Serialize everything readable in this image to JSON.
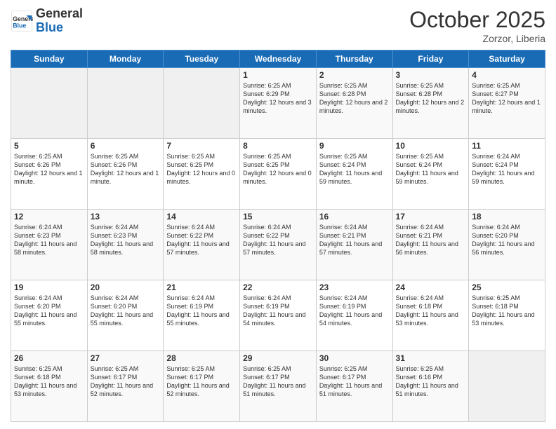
{
  "header": {
    "logo_general": "General",
    "logo_blue": "Blue",
    "month_title": "October 2025",
    "location": "Zorzor, Liberia"
  },
  "days_of_week": [
    "Sunday",
    "Monday",
    "Tuesday",
    "Wednesday",
    "Thursday",
    "Friday",
    "Saturday"
  ],
  "weeks": [
    [
      {
        "day": "",
        "info": ""
      },
      {
        "day": "",
        "info": ""
      },
      {
        "day": "",
        "info": ""
      },
      {
        "day": "1",
        "info": "Sunrise: 6:25 AM\nSunset: 6:29 PM\nDaylight: 12 hours and 3 minutes."
      },
      {
        "day": "2",
        "info": "Sunrise: 6:25 AM\nSunset: 6:28 PM\nDaylight: 12 hours and 2 minutes."
      },
      {
        "day": "3",
        "info": "Sunrise: 6:25 AM\nSunset: 6:28 PM\nDaylight: 12 hours and 2 minutes."
      },
      {
        "day": "4",
        "info": "Sunrise: 6:25 AM\nSunset: 6:27 PM\nDaylight: 12 hours and 1 minute."
      }
    ],
    [
      {
        "day": "5",
        "info": "Sunrise: 6:25 AM\nSunset: 6:26 PM\nDaylight: 12 hours and 1 minute."
      },
      {
        "day": "6",
        "info": "Sunrise: 6:25 AM\nSunset: 6:26 PM\nDaylight: 12 hours and 1 minute."
      },
      {
        "day": "7",
        "info": "Sunrise: 6:25 AM\nSunset: 6:25 PM\nDaylight: 12 hours and 0 minutes."
      },
      {
        "day": "8",
        "info": "Sunrise: 6:25 AM\nSunset: 6:25 PM\nDaylight: 12 hours and 0 minutes."
      },
      {
        "day": "9",
        "info": "Sunrise: 6:25 AM\nSunset: 6:24 PM\nDaylight: 11 hours and 59 minutes."
      },
      {
        "day": "10",
        "info": "Sunrise: 6:25 AM\nSunset: 6:24 PM\nDaylight: 11 hours and 59 minutes."
      },
      {
        "day": "11",
        "info": "Sunrise: 6:24 AM\nSunset: 6:24 PM\nDaylight: 11 hours and 59 minutes."
      }
    ],
    [
      {
        "day": "12",
        "info": "Sunrise: 6:24 AM\nSunset: 6:23 PM\nDaylight: 11 hours and 58 minutes."
      },
      {
        "day": "13",
        "info": "Sunrise: 6:24 AM\nSunset: 6:23 PM\nDaylight: 11 hours and 58 minutes."
      },
      {
        "day": "14",
        "info": "Sunrise: 6:24 AM\nSunset: 6:22 PM\nDaylight: 11 hours and 57 minutes."
      },
      {
        "day": "15",
        "info": "Sunrise: 6:24 AM\nSunset: 6:22 PM\nDaylight: 11 hours and 57 minutes."
      },
      {
        "day": "16",
        "info": "Sunrise: 6:24 AM\nSunset: 6:21 PM\nDaylight: 11 hours and 57 minutes."
      },
      {
        "day": "17",
        "info": "Sunrise: 6:24 AM\nSunset: 6:21 PM\nDaylight: 11 hours and 56 minutes."
      },
      {
        "day": "18",
        "info": "Sunrise: 6:24 AM\nSunset: 6:20 PM\nDaylight: 11 hours and 56 minutes."
      }
    ],
    [
      {
        "day": "19",
        "info": "Sunrise: 6:24 AM\nSunset: 6:20 PM\nDaylight: 11 hours and 55 minutes."
      },
      {
        "day": "20",
        "info": "Sunrise: 6:24 AM\nSunset: 6:20 PM\nDaylight: 11 hours and 55 minutes."
      },
      {
        "day": "21",
        "info": "Sunrise: 6:24 AM\nSunset: 6:19 PM\nDaylight: 11 hours and 55 minutes."
      },
      {
        "day": "22",
        "info": "Sunrise: 6:24 AM\nSunset: 6:19 PM\nDaylight: 11 hours and 54 minutes."
      },
      {
        "day": "23",
        "info": "Sunrise: 6:24 AM\nSunset: 6:19 PM\nDaylight: 11 hours and 54 minutes."
      },
      {
        "day": "24",
        "info": "Sunrise: 6:24 AM\nSunset: 6:18 PM\nDaylight: 11 hours and 53 minutes."
      },
      {
        "day": "25",
        "info": "Sunrise: 6:25 AM\nSunset: 6:18 PM\nDaylight: 11 hours and 53 minutes."
      }
    ],
    [
      {
        "day": "26",
        "info": "Sunrise: 6:25 AM\nSunset: 6:18 PM\nDaylight: 11 hours and 53 minutes."
      },
      {
        "day": "27",
        "info": "Sunrise: 6:25 AM\nSunset: 6:17 PM\nDaylight: 11 hours and 52 minutes."
      },
      {
        "day": "28",
        "info": "Sunrise: 6:25 AM\nSunset: 6:17 PM\nDaylight: 11 hours and 52 minutes."
      },
      {
        "day": "29",
        "info": "Sunrise: 6:25 AM\nSunset: 6:17 PM\nDaylight: 11 hours and 51 minutes."
      },
      {
        "day": "30",
        "info": "Sunrise: 6:25 AM\nSunset: 6:17 PM\nDaylight: 11 hours and 51 minutes."
      },
      {
        "day": "31",
        "info": "Sunrise: 6:25 AM\nSunset: 6:16 PM\nDaylight: 11 hours and 51 minutes."
      },
      {
        "day": "",
        "info": ""
      }
    ]
  ]
}
